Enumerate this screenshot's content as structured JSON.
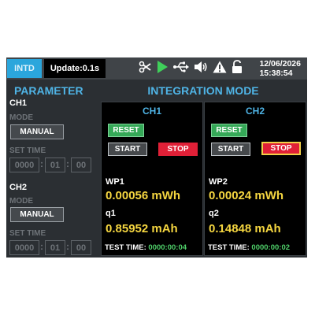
{
  "topbar": {
    "mode_badge": "INTD",
    "update": "Update:0.1s",
    "date": "12/06/2026",
    "time": "15:38:54",
    "icons": [
      "scissors-icon",
      "play-icon",
      "usb-icon",
      "speaker-icon",
      "warning-icon",
      "unlock-icon"
    ]
  },
  "left": {
    "title": "PARAMETER",
    "mode_label": "MODE",
    "set_time_label": "SET TIME",
    "ch1": {
      "label": "CH1",
      "mode": "MANUAL",
      "time": [
        "0000",
        "01",
        "00"
      ]
    },
    "ch2": {
      "label": "CH2",
      "mode": "MANUAL",
      "time": [
        "0000",
        "01",
        "00"
      ]
    }
  },
  "main": {
    "title": "INTEGRATION MODE",
    "reset_label": "RESET",
    "start_label": "START",
    "stop_label": "STOP",
    "test_time_label": "TEST TIME:",
    "ch1": {
      "name": "CH1",
      "wp_label": "WP1",
      "wp_value": "0.00056 mWh",
      "q_label": "q1",
      "q_value": "0.85952 mAh",
      "test_time": "0000:00:04"
    },
    "ch2": {
      "name": "CH2",
      "wp_label": "WP2",
      "wp_value": "0.00024 mWh",
      "q_label": "q2",
      "q_value": "0.14848 mAh",
      "test_time": "0000:00:02"
    }
  },
  "colors": {
    "accent": "#4fb4e6",
    "value": "#f5d640",
    "reset": "#35a857",
    "stop": "#e02037",
    "timer": "#4fd16a"
  }
}
